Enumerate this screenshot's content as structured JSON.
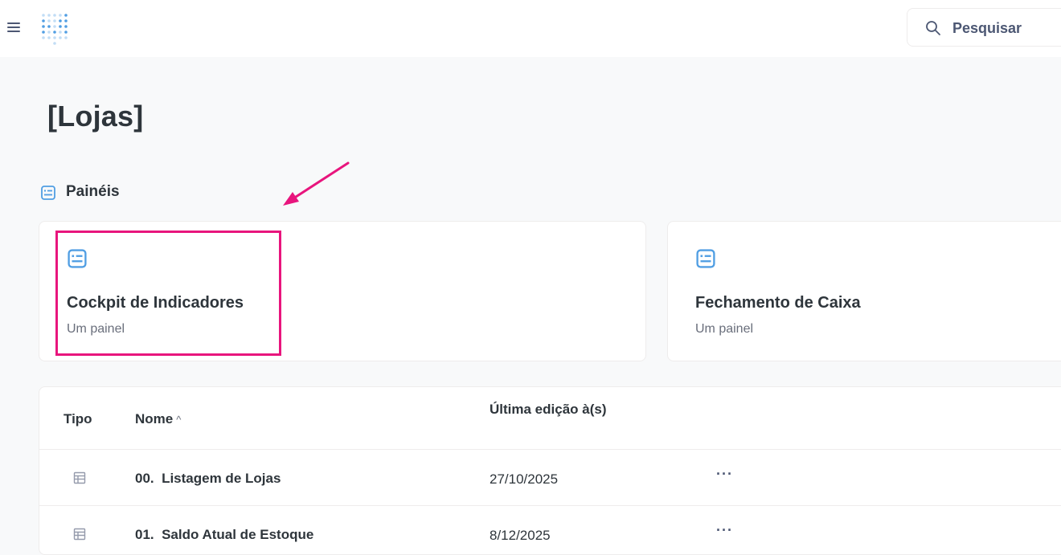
{
  "header": {
    "menu_icon": "hamburger-icon",
    "logo_icon": "metabase-dots-logo",
    "search": {
      "label": "Pesquisar",
      "icon": "search-icon"
    }
  },
  "page": {
    "title": "[Lojas]"
  },
  "section": {
    "label": "Painéis",
    "icon": "dashboard-icon"
  },
  "cards": [
    {
      "title": "Cockpit de Indicadores",
      "subtitle": "Um painel",
      "icon": "dashboard-icon"
    },
    {
      "title": "Fechamento de Caixa",
      "subtitle": "Um painel",
      "icon": "dashboard-icon"
    }
  ],
  "table": {
    "headers": {
      "type": "Tipo",
      "name": "Nome",
      "sort_icon": "caret-up-icon",
      "last_edit": "Última edição à(s)"
    },
    "rows": [
      {
        "name": "00.  Listagem de Lojas",
        "date": "27/10/2025",
        "more": "···",
        "icon": "table-icon"
      },
      {
        "name": "01.  Saldo Atual de Estoque",
        "date": "8/12/2025",
        "more": "···",
        "icon": "table-icon"
      }
    ]
  },
  "colors": {
    "brand": "#509ee3",
    "annotation": "#e8157d",
    "text": "#2e353b",
    "muted": "#696e7b"
  }
}
